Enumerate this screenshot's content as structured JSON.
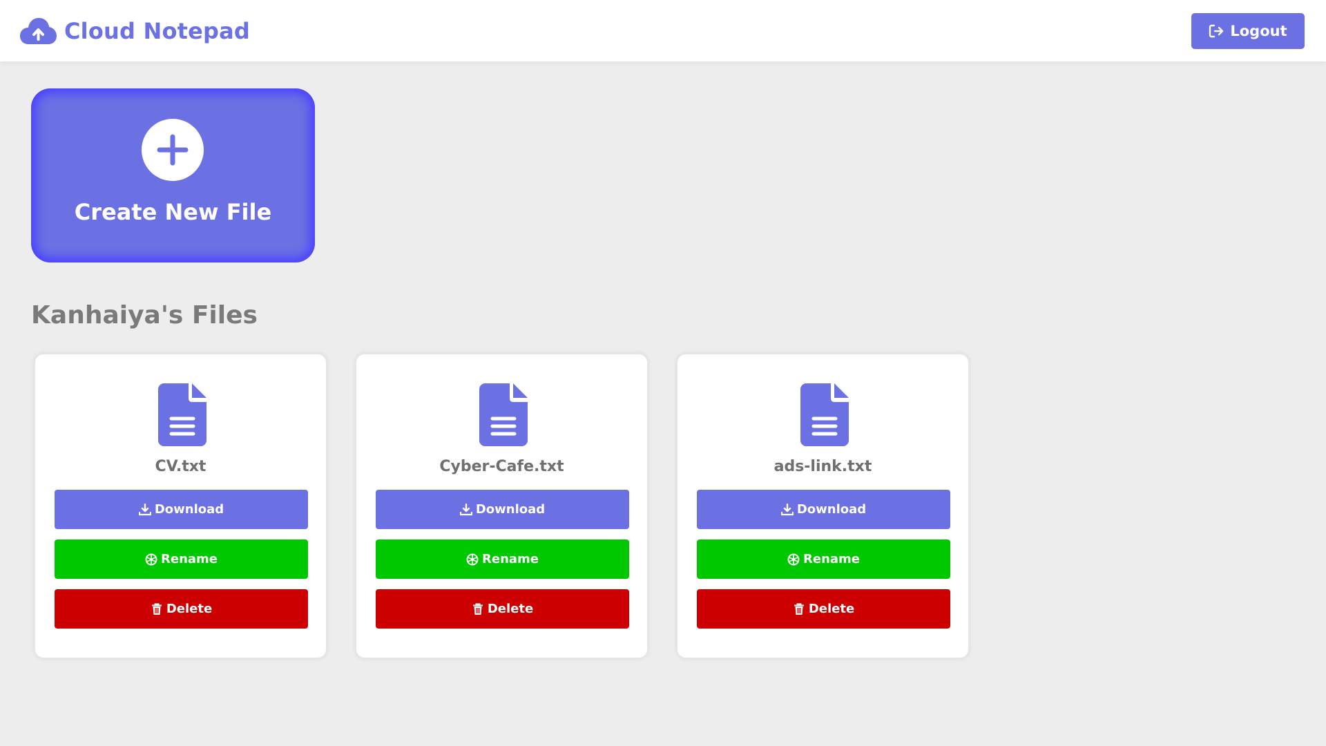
{
  "app": {
    "title": "Cloud Notepad",
    "logo_icon": "cloud-upload-icon",
    "accent_color": "#6b70e3"
  },
  "header": {
    "logout_label": "Logout",
    "logout_icon": "sign-out-icon"
  },
  "create": {
    "label": "Create New File",
    "icon": "plus-circle-icon"
  },
  "files_section": {
    "title": "Kanhaiya's Files"
  },
  "files": [
    {
      "name": "CV.txt",
      "download_label": "Download",
      "rename_label": "Rename",
      "delete_label": "Delete"
    },
    {
      "name": "Cyber-Cafe.txt",
      "download_label": "Download",
      "rename_label": "Rename",
      "delete_label": "Delete"
    },
    {
      "name": "ads-link.txt",
      "download_label": "Download",
      "rename_label": "Rename",
      "delete_label": "Delete"
    }
  ],
  "colors": {
    "download": "#6b70e3",
    "rename": "#00c800",
    "delete": "#cc0000"
  }
}
